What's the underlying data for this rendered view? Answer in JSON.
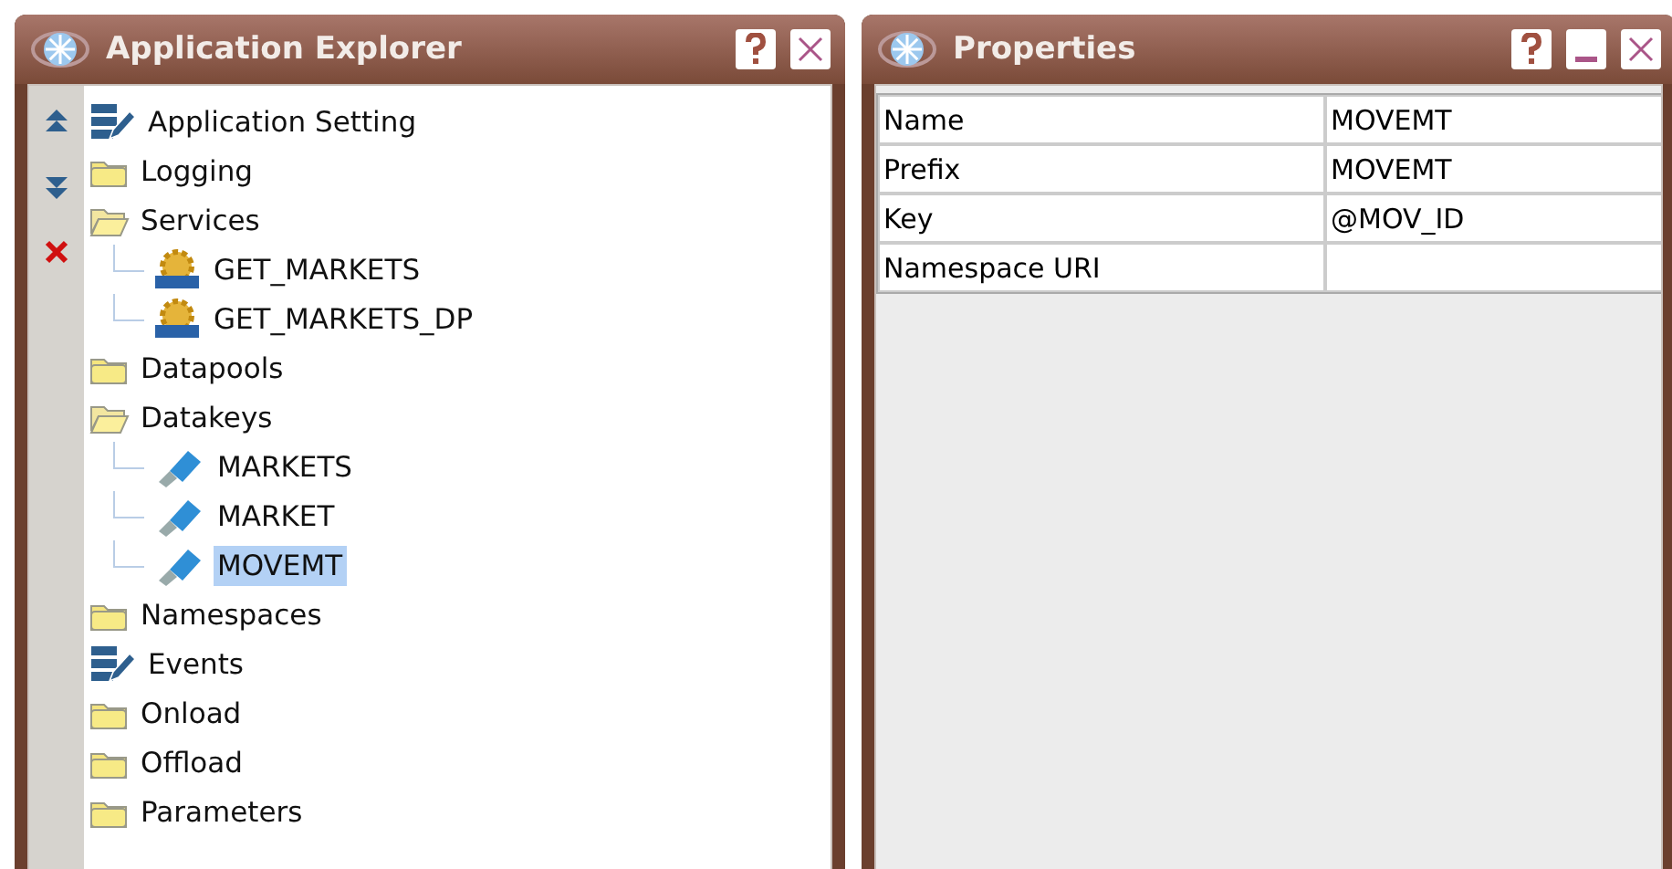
{
  "explorer": {
    "title": "Application Explorer",
    "tree": [
      {
        "label": "Application Setting",
        "kind": "settings",
        "selected": false
      },
      {
        "label": "Logging",
        "kind": "folder",
        "expanded": false,
        "selected": false
      },
      {
        "label": "Services",
        "kind": "folder",
        "expanded": true,
        "selected": false,
        "children": [
          {
            "label": "GET_MARKETS",
            "kind": "http",
            "selected": false
          },
          {
            "label": "GET_MARKETS_DP",
            "kind": "http",
            "selected": false
          }
        ]
      },
      {
        "label": "Datapools",
        "kind": "folder",
        "expanded": false,
        "selected": false
      },
      {
        "label": "Datakeys",
        "kind": "folder",
        "expanded": true,
        "selected": false,
        "children": [
          {
            "label": "MARKETS",
            "kind": "key",
            "selected": false
          },
          {
            "label": "MARKET",
            "kind": "key",
            "selected": false
          },
          {
            "label": "MOVEMT",
            "kind": "key",
            "selected": true
          }
        ]
      },
      {
        "label": "Namespaces",
        "kind": "folder",
        "expanded": false,
        "selected": false
      },
      {
        "label": "Events",
        "kind": "settings",
        "selected": false
      },
      {
        "label": "Onload",
        "kind": "folder",
        "expanded": false,
        "selected": false
      },
      {
        "label": "Offload",
        "kind": "folder",
        "expanded": false,
        "selected": false
      },
      {
        "label": "Parameters",
        "kind": "folder",
        "expanded": false,
        "selected": false
      }
    ]
  },
  "properties": {
    "title": "Properties",
    "rows": [
      {
        "name": "Name",
        "value": "MOVEMT"
      },
      {
        "name": "Prefix",
        "value": "MOVEMT"
      },
      {
        "name": "Key",
        "value": "@MOV_ID"
      },
      {
        "name": "Namespace URI",
        "value": ""
      }
    ]
  }
}
